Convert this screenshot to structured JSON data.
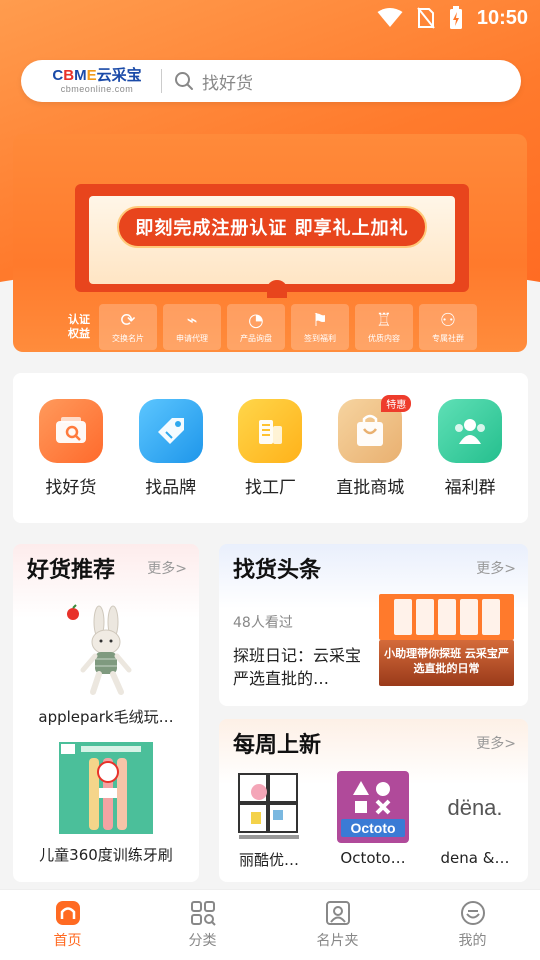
{
  "status_bar": {
    "time": "10:50"
  },
  "search": {
    "logo_text": "CBME云采宝",
    "logo_sub": "cbmeonline.com",
    "placeholder": "找好货"
  },
  "banner": {
    "headline": "即刻完成注册认证 即享礼上加礼",
    "benefits_title": "认证权益",
    "benefits": [
      {
        "icon": "exchange-icon",
        "label": "交换名片"
      },
      {
        "icon": "agent-icon",
        "label": "申请代理"
      },
      {
        "icon": "inquiry-icon",
        "label": "产品询盘"
      },
      {
        "icon": "flag-icon",
        "label": "签到福利"
      },
      {
        "icon": "award-icon",
        "label": "优质内容"
      },
      {
        "icon": "community-icon",
        "label": "专属社群"
      }
    ]
  },
  "categories": [
    {
      "label": "找好货",
      "color": "#ff7a3c",
      "icon": "goods-search-icon"
    },
    {
      "label": "找品牌",
      "color": "#2fa8ee",
      "icon": "tag-icon"
    },
    {
      "label": "找工厂",
      "color": "#ffc22e",
      "icon": "factory-icon"
    },
    {
      "label": "直批商城",
      "color": "#f0c48a",
      "icon": "shopping-bag-icon",
      "badge": "特惠"
    },
    {
      "label": "福利群",
      "color": "#3fcfa0",
      "icon": "group-icon"
    }
  ],
  "good_picks": {
    "title": "好货推荐",
    "more": "更多>",
    "items": [
      {
        "name": "applepark毛绒玩…"
      },
      {
        "name": "儿童360度训练牙刷"
      }
    ]
  },
  "headlines": {
    "title": "找货头条",
    "more": "更多>",
    "views": "48人看过",
    "article": "探班日记：云采宝严选直批的…",
    "image_caption": "小助理带你探班 云采宝严选直批的日常"
  },
  "weekly_new": {
    "title": "每周上新",
    "more": "更多>",
    "brands": [
      {
        "name": "丽酷优…"
      },
      {
        "name": "Octoto…"
      },
      {
        "name": "dena &…"
      }
    ]
  },
  "bottom_nav": [
    {
      "label": "首页",
      "icon": "home-icon",
      "active": true
    },
    {
      "label": "分类",
      "icon": "category-icon",
      "active": false
    },
    {
      "label": "名片夹",
      "icon": "card-holder-icon",
      "active": false
    },
    {
      "label": "我的",
      "icon": "profile-icon",
      "active": false
    }
  ]
}
